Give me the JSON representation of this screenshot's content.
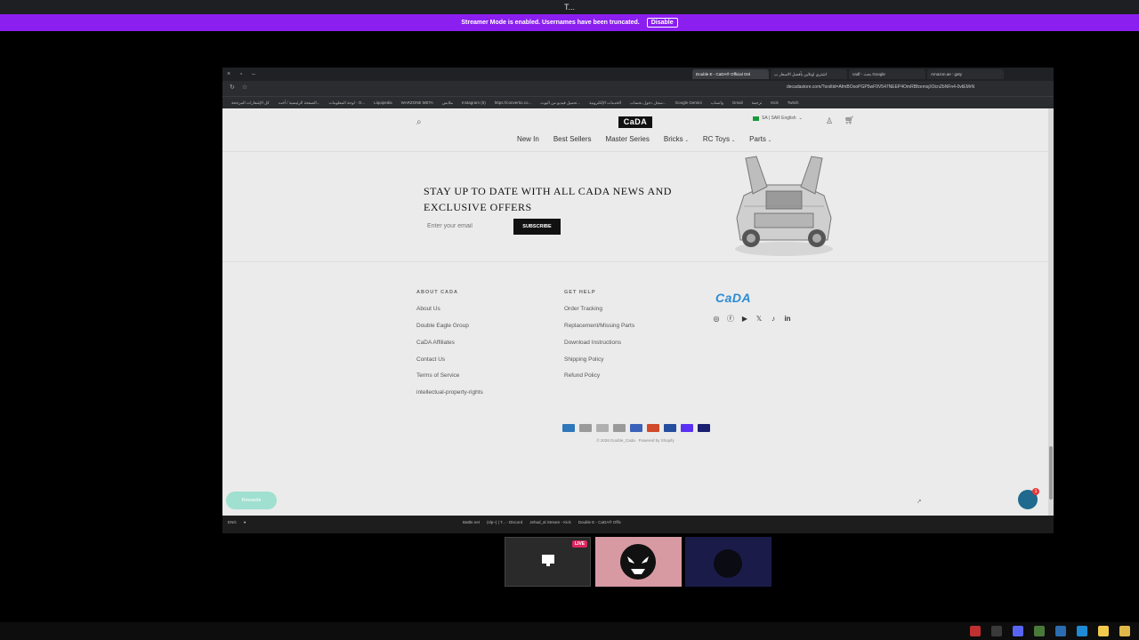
{
  "discord": {
    "top_title": "T...",
    "streamer_banner": "Streamer Mode is enabled. Usernames have been truncated.",
    "disable_label": "Disable"
  },
  "browser": {
    "tabs": [
      {
        "label": "Double E - CaDA® Official Onl",
        "active": true
      },
      {
        "label": "اشتري اونلاين بأفضل الاسعار ب",
        "active": false
      },
      {
        "label": "cadf - بحث Google",
        "active": false
      },
      {
        "label": "Amazon.ae : gaty",
        "active": false
      }
    ],
    "url": "decadastore.com/?srsltid=AfmBOooPGP5wF9V547NEEP4OmRBfzemsjX0cnZbNFn4-0vtEMrN",
    "bookmarks": [
      "كل الإشعارات المرجحة",
      "الصفحة الرئيسية / أخت...",
      "لوحة المعلومات - O...",
      "Liquipedia",
      "WARZONE META",
      "ملابس",
      "Instagram (5)",
      "https://convertio.co...",
      "تحميل فيديو من اليوت...",
      "الخدمات الإلكترونية",
      "سجل دخول بحساب...",
      "Google Gemini",
      "واتساب",
      "Gmail",
      "ترجمة",
      "Kick",
      "Twitch"
    ]
  },
  "site": {
    "logo": "CaDA",
    "region": "SA | SAR English",
    "nav": [
      {
        "label": "New In",
        "dropdown": false
      },
      {
        "label": "Best Sellers",
        "dropdown": false
      },
      {
        "label": "Master Series",
        "dropdown": false
      },
      {
        "label": "Bricks",
        "dropdown": true
      },
      {
        "label": "RC Toys",
        "dropdown": true
      },
      {
        "label": "Parts",
        "dropdown": true
      }
    ],
    "newsletter": {
      "title": "STAY UP TO DATE WITH ALL CADA NEWS AND EXCLUSIVE OFFERS",
      "email_placeholder": "Enter your email",
      "subscribe_label": "SUBSCRIBE"
    },
    "footer": {
      "about_heading": "ABOUT CADA",
      "about_links": [
        "About Us",
        "Double Eagle Group",
        "CaDA Affiliates",
        "Contact Us",
        "Terms of Service",
        "intellectual-property-rights"
      ],
      "help_heading": "GET HELP",
      "help_links": [
        "Order Tracking",
        "Replacement/Missing Parts",
        "Download Instructions",
        "Shipping Policy",
        "Refund Policy"
      ],
      "logo": "CaDA",
      "socials": [
        "instagram-icon",
        "facebook-icon",
        "youtube-icon",
        "x-icon",
        "tiktok-icon",
        "linkedin-icon"
      ],
      "payments": [
        {
          "name": "amex-icon",
          "color": "#2e77bb"
        },
        {
          "name": "apple-pay-icon",
          "color": "#9a9a9a"
        },
        {
          "name": "discover-icon",
          "color": "#b0b0b0"
        },
        {
          "name": "google-pay-icon",
          "color": "#9a9a9a"
        },
        {
          "name": "maestro-icon",
          "color": "#3a62b8"
        },
        {
          "name": "mastercard-icon",
          "color": "#d04a2b"
        },
        {
          "name": "paypal-icon",
          "color": "#244f9e"
        },
        {
          "name": "shop-pay-icon",
          "color": "#5a31f4"
        },
        {
          "name": "visa-icon",
          "color": "#1a1f71"
        }
      ],
      "copyright": "© 2026 Double_Cada · Powered by Shopify"
    },
    "rewards_label": "Rewards",
    "chat_badge": "1"
  },
  "taskbar": {
    "lang": "ENG",
    "items": [
      "Battle.net",
      "(slp~) | T... - Discord",
      "Jehad_al Stream - Kick",
      "Double E - CaDA® Offic"
    ]
  },
  "stream": {
    "live_label": "LIVE"
  }
}
